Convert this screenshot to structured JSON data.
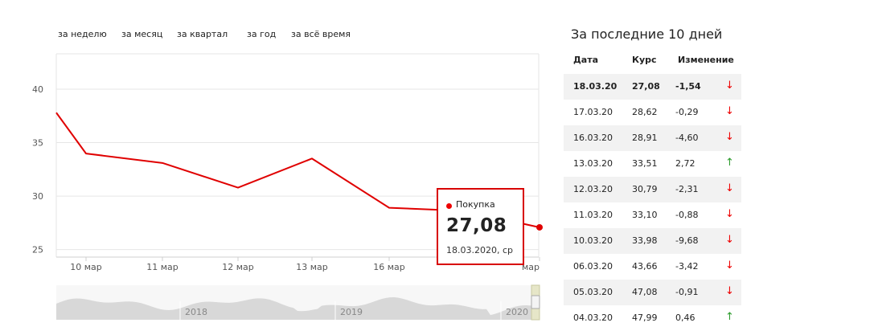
{
  "periods": [
    "за неделю",
    "за месяц",
    "за квартал",
    "за год",
    "за всё время"
  ],
  "side": {
    "title": "За последние 10 дней",
    "headers": {
      "date": "Дата",
      "rate": "Курс",
      "change": "Изменение"
    },
    "rows": [
      {
        "date": "18.03.20",
        "rate": "27,08",
        "change": "-1,54",
        "dir": "down"
      },
      {
        "date": "17.03.20",
        "rate": "28,62",
        "change": "-0,29",
        "dir": "down"
      },
      {
        "date": "16.03.20",
        "rate": "28,91",
        "change": "-4,60",
        "dir": "down"
      },
      {
        "date": "13.03.20",
        "rate": "33,51",
        "change": "2,72",
        "dir": "up"
      },
      {
        "date": "12.03.20",
        "rate": "30,79",
        "change": "-2,31",
        "dir": "down"
      },
      {
        "date": "11.03.20",
        "rate": "33,10",
        "change": "-0,88",
        "dir": "down"
      },
      {
        "date": "10.03.20",
        "rate": "33,98",
        "change": "-9,68",
        "dir": "down"
      },
      {
        "date": "06.03.20",
        "rate": "43,66",
        "change": "-3,42",
        "dir": "down"
      },
      {
        "date": "05.03.20",
        "rate": "47,08",
        "change": "-0,91",
        "dir": "down"
      },
      {
        "date": "04.03.20",
        "rate": "47,99",
        "change": "0,46",
        "dir": "up"
      }
    ]
  },
  "tooltip": {
    "series": "Покупка",
    "value": "27,08",
    "date": "18.03.2020, ср"
  },
  "colors": {
    "line": "#e00000",
    "up": "#2a9a2a",
    "down": "#e00000"
  },
  "chart_data": {
    "type": "line",
    "series": [
      {
        "name": "Покупка",
        "values": [
          37.8,
          33.98,
          33.1,
          30.79,
          33.51,
          28.91,
          28.62,
          27.08
        ]
      }
    ],
    "x": [
      "",
      "10 мар",
      "11 мар",
      "12 мар",
      "13 мар",
      "16 мар",
      "",
      "мар"
    ],
    "yticks": [
      25,
      30,
      35,
      40
    ],
    "ylim": [
      24.3,
      43.3
    ],
    "grid": true,
    "navigator": {
      "labels": [
        "2018",
        "2019",
        "2020"
      ]
    }
  }
}
